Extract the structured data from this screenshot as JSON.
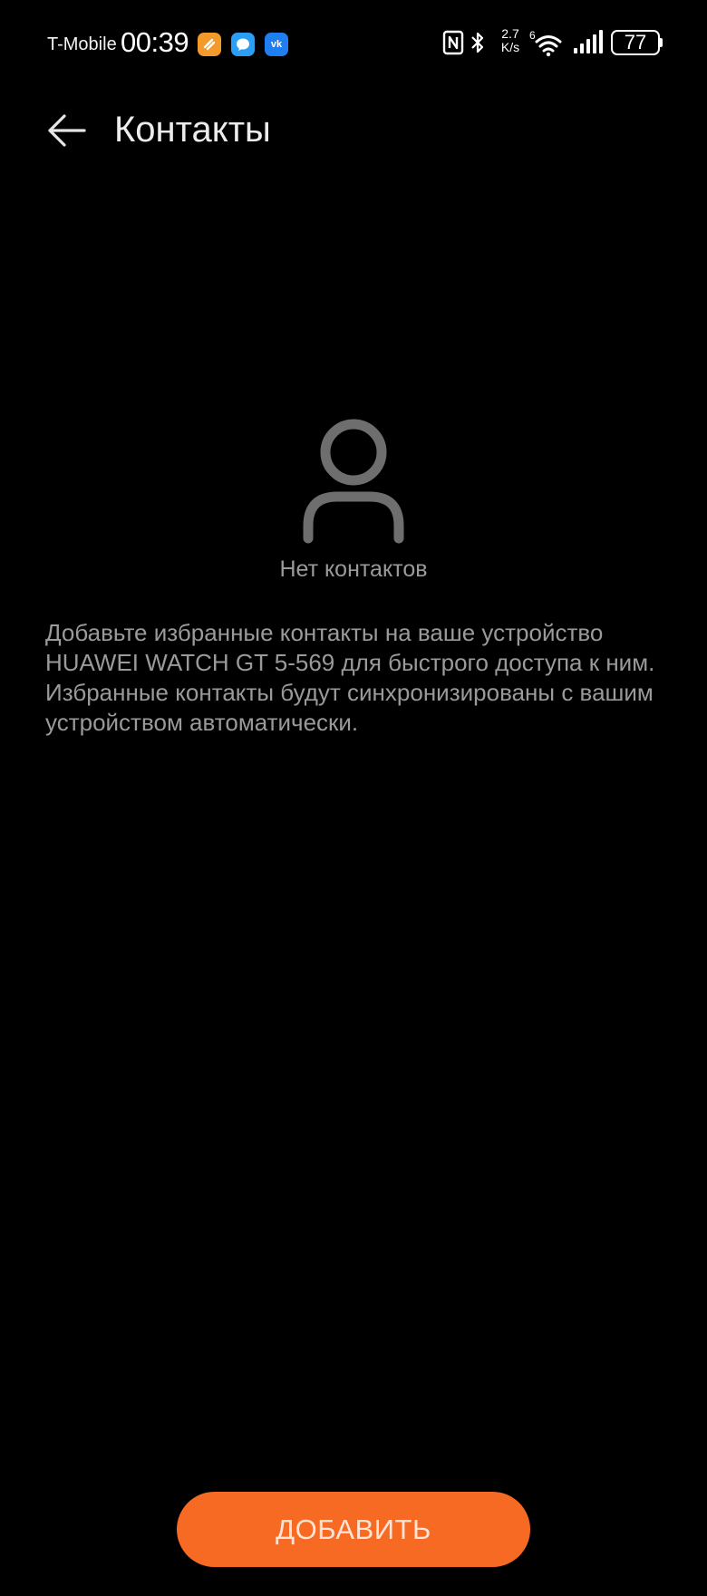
{
  "status_bar": {
    "carrier": "T-Mobile",
    "time": "00:39",
    "notification_icons": [
      "orange-app-icon",
      "messenger-icon",
      "vk-icon"
    ],
    "vk_label": "vk",
    "net_speed_value": "2.7",
    "net_speed_unit": "K/s",
    "wifi_label": "6",
    "battery": "77",
    "icons": [
      "nfc-icon",
      "bluetooth-icon",
      "wifi-icon",
      "signal-icon",
      "battery-icon"
    ]
  },
  "header": {
    "back_icon": "arrow-left-icon",
    "title": "Контакты"
  },
  "empty_state": {
    "icon": "person-icon",
    "label": "Нет контактов",
    "description": "Добавьте избранные контакты на ваше устройство HUAWEI WATCH GT 5-569 для быстрого доступа к ним. Избранные контакты будут синхронизированы с вашим устройством автоматически."
  },
  "actions": {
    "add_label": "ДОБАВИТЬ"
  },
  "colors": {
    "background": "#000000",
    "accent": "#f76a24",
    "secondary_text": "#9a9a9a",
    "icon_gray": "#6e6e6e"
  }
}
